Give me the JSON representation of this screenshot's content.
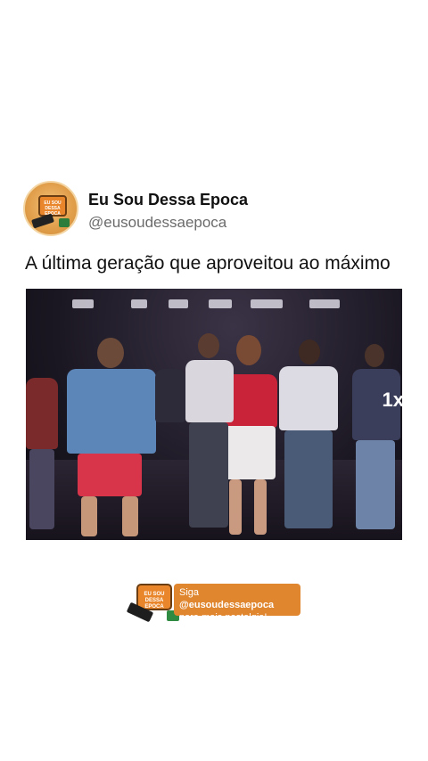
{
  "post": {
    "display_name": "Eu Sou Dessa Epoca",
    "handle": "@eusoudessaepoca",
    "caption": "A última geração que aproveitou ao máximo"
  },
  "video": {
    "speed_label": "1x"
  },
  "follow_banner": {
    "prefix": "Siga ",
    "handle": "@eusoudessaepoca",
    "line2": "para mais nostalgia!"
  },
  "colors": {
    "accent": "#e0862f",
    "text_primary": "#111111",
    "text_secondary": "#6b6b6b"
  },
  "icons": {
    "avatar": "retro-tv-logo-icon",
    "follow_logo": "retro-tv-logo-icon"
  }
}
